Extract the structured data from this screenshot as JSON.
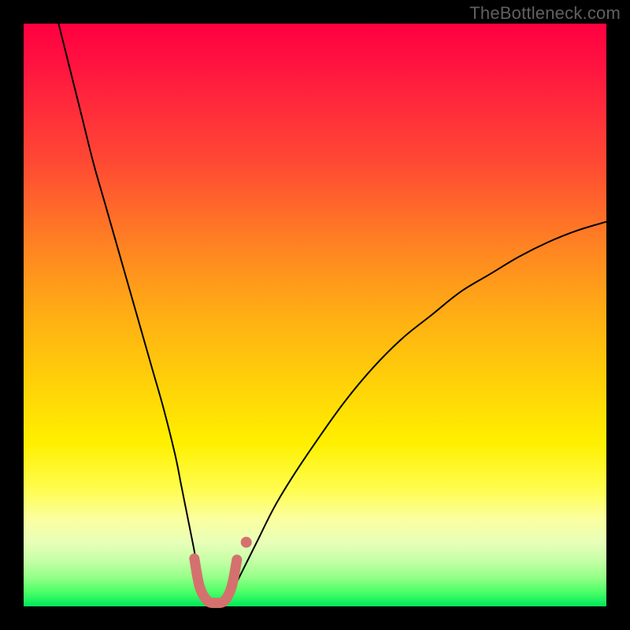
{
  "watermark": "TheBottleneck.com",
  "chart_data": {
    "type": "line",
    "title": "",
    "xlabel": "",
    "ylabel": "",
    "xlim": [
      0,
      100
    ],
    "ylim": [
      0,
      100
    ],
    "grid": false,
    "legend": false,
    "series": [
      {
        "name": "curve",
        "color": "#000000",
        "stroke_width": 2,
        "x": [
          6,
          8,
          10,
          12,
          14,
          16,
          18,
          20,
          22,
          24,
          26,
          27,
          28,
          29,
          30,
          31,
          32,
          33,
          34,
          35,
          36,
          38,
          40,
          43,
          46,
          50,
          55,
          60,
          65,
          70,
          75,
          80,
          85,
          90,
          95,
          100
        ],
        "y": [
          100,
          92,
          84,
          76,
          69,
          62,
          55,
          48,
          41,
          34,
          26,
          21,
          16,
          11,
          6,
          3,
          1,
          0.5,
          0.5,
          1,
          3,
          7,
          11,
          17,
          22,
          28,
          35,
          41,
          46,
          50,
          54,
          57,
          60,
          62.5,
          64.5,
          66
        ]
      },
      {
        "name": "trough-marker",
        "color": "#d4716e",
        "stroke_width": 13,
        "linecap": "round",
        "x": [
          29.3,
          30.2,
          31.5,
          33.0,
          34.5,
          35.7,
          36.6
        ],
        "y": [
          8.2,
          3.4,
          1.0,
          0.6,
          1.0,
          3.4,
          8.0
        ]
      },
      {
        "name": "trough-dot",
        "color": "#d4716e",
        "type": "scatter",
        "radius": 7,
        "x": [
          38.2
        ],
        "y": [
          11.0
        ]
      }
    ],
    "background_gradient": {
      "direction": "top-to-bottom",
      "stops": [
        {
          "pos": 0.0,
          "color": "#ff0040"
        },
        {
          "pos": 0.5,
          "color": "#ffae14"
        },
        {
          "pos": 0.8,
          "color": "#fffd50"
        },
        {
          "pos": 1.0,
          "color": "#00e85a"
        }
      ]
    }
  }
}
